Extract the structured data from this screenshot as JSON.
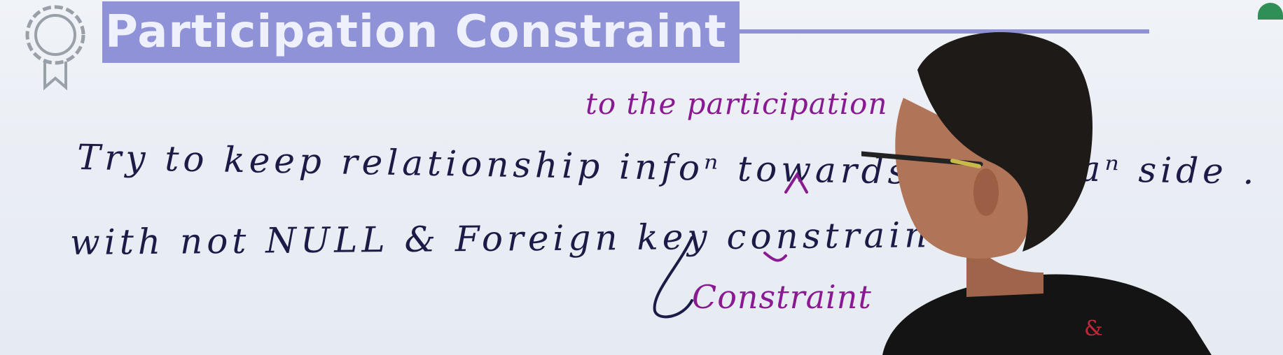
{
  "slide": {
    "title": "Participation Constraint"
  },
  "whiteboard": {
    "line1": "Try to keep relationship infoⁿ towards ^ to",
    "line1_tail": "eaⁿ side .",
    "line2": "with not NULL & Foreign key constrain",
    "annotation_top": "to the participation",
    "annotation_bottom": "Constraint"
  },
  "colors": {
    "title_band": "#8f92d6",
    "title_text": "#eef0fb",
    "dark_ink": "#1c1b47",
    "purple_ink": "#8a1a92",
    "board": "#eaeef4"
  },
  "icons": {
    "badge": "award-ribbon-icon"
  }
}
